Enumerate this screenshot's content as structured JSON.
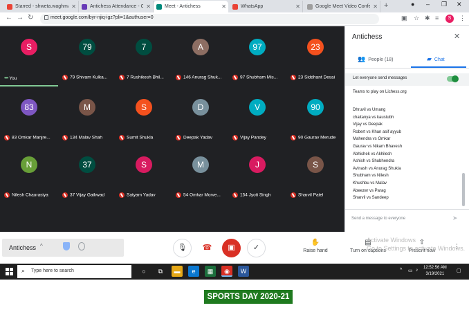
{
  "browser": {
    "tabs": [
      {
        "title": "Starred - shweta.waghmare@...",
        "favicon_color": "#ea4335"
      },
      {
        "title": "Antichess Attendance - Googl...",
        "favicon_color": "#673ab7"
      },
      {
        "title": "Meet - Antichess",
        "favicon_color": "#00897b",
        "active": true
      },
      {
        "title": "WhatsApp",
        "favicon_color": "#ea4335"
      },
      {
        "title": "Google Meet Video Confere...",
        "favicon_color": "#9e9e9e"
      }
    ],
    "url": "meet.google.com/byr-njiq-igz?pli=1&authuser=0",
    "profile_initial": "S"
  },
  "meet": {
    "participants": [
      {
        "avatar": "S",
        "color": "#e91e63",
        "name": "You",
        "self": true
      },
      {
        "avatar": "79",
        "color": "#004d40",
        "name": "79 Shivam Kulka..."
      },
      {
        "avatar": "7",
        "color": "#004d40",
        "name": "7 Rushikesh Bhil..."
      },
      {
        "avatar": "A",
        "color": "#8d6e63",
        "name": "146 Anurag Shuk..."
      },
      {
        "avatar": "97",
        "color": "#00acc1",
        "name": "97 Shubham Mis..."
      },
      {
        "avatar": "23",
        "color": "#f4511e",
        "name": "23 Siddhant Desai"
      },
      {
        "avatar": "83",
        "color": "#7e57c2",
        "name": "83 Omkar Manjre..."
      },
      {
        "avatar": "M",
        "color": "#795548",
        "name": "134 Malav Shah"
      },
      {
        "avatar": "S",
        "color": "#f4511e",
        "name": "Sumit Shukla"
      },
      {
        "avatar": "D",
        "color": "#78909c",
        "name": "Deepak Yadav"
      },
      {
        "avatar": "V",
        "color": "#00acc1",
        "name": "Vijay Pandey"
      },
      {
        "avatar": "90",
        "color": "#00acc1",
        "name": "90 Gaurav Merude"
      },
      {
        "avatar": "N",
        "color": "#689f38",
        "name": "Nilesh Chaurasiya"
      },
      {
        "avatar": "37",
        "color": "#004d40",
        "name": "37 Vijay Gaikwad"
      },
      {
        "avatar": "S",
        "color": "#d81b60",
        "name": "Satyam Yadav"
      },
      {
        "avatar": "M",
        "color": "#78909c",
        "name": "54 Omkar Morve..."
      },
      {
        "avatar": "J",
        "color": "#d81b60",
        "name": "154 Jyoti Singh"
      },
      {
        "avatar": "S",
        "color": "#795548",
        "name": "Sharvil Patel"
      }
    ]
  },
  "controls": {
    "meeting_name": "Antichess",
    "raise_hand": "Raise hand",
    "captions": "Turn on captions",
    "present": "Present now",
    "activate_title": "Activate Windows",
    "activate_sub": "Go to Settings to activate Windows."
  },
  "panel": {
    "title": "Antichess",
    "people_tab": "People (18)",
    "chat_tab": "Chat",
    "allow_messages": "Let everyone send messages",
    "chat_heading": "Teams to play on Lichess.org",
    "matches": [
      "Dhruvil vs Umang",
      "chaitanya vs kaustubh",
      "Vijay vs Deepak",
      "Robert vs Khan asif ayyub",
      "Mahendra vs Omkar",
      "Gaurav vs Nikam Bhavesh",
      "Abhishek vs Akhilesh",
      "Ashish vs Shubhendra",
      "Avinash vs Anurag Shukla",
      "Shubham vs Nilesh",
      "Khushbu vs Malav",
      "Abeezer vs Parag",
      "Sharvil vs Sandeep"
    ],
    "input_placeholder": "Send a message to everyone"
  },
  "taskbar": {
    "search_placeholder": "Type here to search",
    "time": "12:52:56 AM",
    "date": "3/19/2021"
  },
  "caption": "SPORTS DAY 2020-21"
}
